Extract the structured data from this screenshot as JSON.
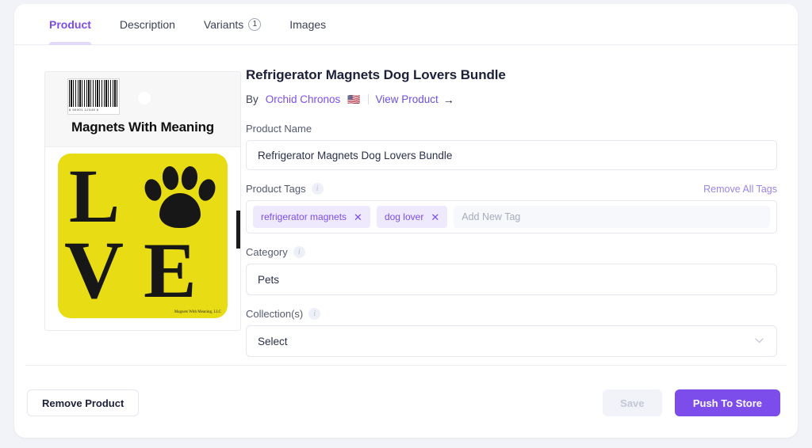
{
  "tabs": [
    {
      "label": "Product",
      "active": true,
      "badge": null
    },
    {
      "label": "Description",
      "active": false,
      "badge": null
    },
    {
      "label": "Variants",
      "active": false,
      "badge": "1"
    },
    {
      "label": "Images",
      "active": false,
      "badge": null
    }
  ],
  "product": {
    "title": "Refrigerator Magnets Dog Lovers Bundle",
    "by_prefix": "By",
    "vendor": "Orchid Chronos",
    "vendor_flag": "🇺🇸",
    "view_product_label": "View Product",
    "view_product_arrow": "→"
  },
  "image": {
    "package_brand": "Magnets With Meaning",
    "barcode_number": "8 50001 12345 6",
    "magnet_text_line1": "L",
    "magnet_text_line2": "V",
    "magnet_text_line3": "E",
    "magnet_credit": "Magnets With Meaning, LLC",
    "alt": "product-photo"
  },
  "fields": {
    "product_name": {
      "label": "Product Name",
      "value": "Refrigerator Magnets Dog Lovers Bundle"
    },
    "product_tags": {
      "label": "Product Tags",
      "info": "i",
      "remove_all_label": "Remove All Tags",
      "tags": [
        {
          "label": "refrigerator magnets",
          "remove": "✕"
        },
        {
          "label": "dog lover",
          "remove": "✕"
        }
      ],
      "new_tag_placeholder": "Add New Tag",
      "new_tag_value": ""
    },
    "category": {
      "label": "Category",
      "info": "i",
      "value": "Pets"
    },
    "collections": {
      "label": "Collection(s)",
      "info": "i",
      "value": "Select",
      "chevron": "⌄"
    }
  },
  "footer": {
    "remove_label": "Remove Product",
    "save_label": "Save",
    "push_label": "Push To Store"
  },
  "colors": {
    "accent": "#7c4dea",
    "accent_soft": "#eee9fd",
    "text": "#1c2038",
    "muted": "#555a70",
    "border": "#e4e7ef",
    "page_bg": "#f2f3f8",
    "magnet_yellow": "#e8dc15"
  }
}
